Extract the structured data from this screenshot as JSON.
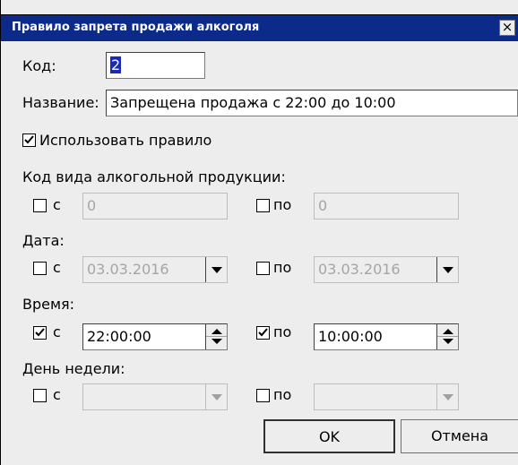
{
  "window": {
    "title": "Правило запрета продажи алкоголя",
    "close_label": "×"
  },
  "code": {
    "label": "Код:",
    "value": "2"
  },
  "name": {
    "label": "Название:",
    "value": "Запрещена продажа с 22:00 до 10:00"
  },
  "use_rule": {
    "label": "Использовать правило",
    "checked": true
  },
  "alcohol_code": {
    "label": "Код вида алкогольной продукции:",
    "from": {
      "label": "с",
      "checked": false,
      "value": "0"
    },
    "to": {
      "label": "по",
      "checked": false,
      "value": "0"
    }
  },
  "date": {
    "label": "Дата:",
    "from": {
      "label": "с",
      "checked": false,
      "value": "03.03.2016"
    },
    "to": {
      "label": "по",
      "checked": false,
      "value": "03.03.2016"
    }
  },
  "time": {
    "label": "Время:",
    "from": {
      "label": "с",
      "checked": true,
      "value": "22:00:00"
    },
    "to": {
      "label": "по",
      "checked": true,
      "value": "10:00:00"
    }
  },
  "weekday": {
    "label": "День недели:",
    "from": {
      "label": "с",
      "checked": false,
      "value": ""
    },
    "to": {
      "label": "по",
      "checked": false,
      "value": ""
    }
  },
  "buttons": {
    "ok": "OK",
    "cancel": "Отмена"
  }
}
